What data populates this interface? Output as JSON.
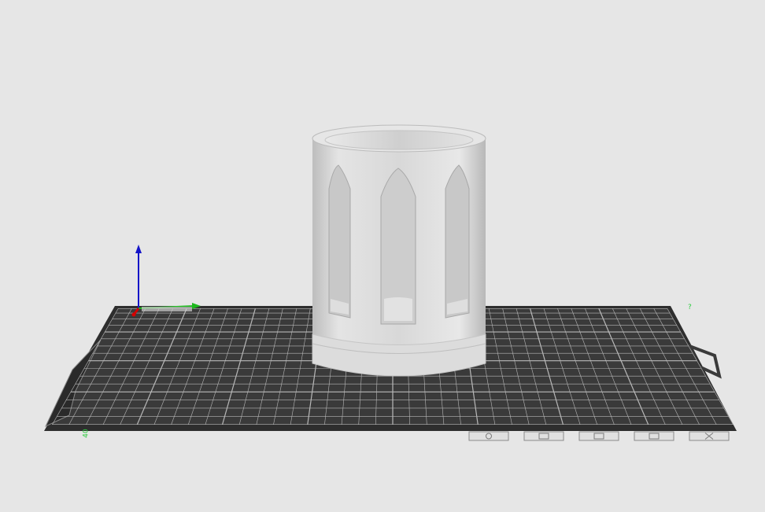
{
  "app": {
    "view": "3d-plater-viewport"
  },
  "scene": {
    "bed_labels": {
      "front_left": "40",
      "back_right": "?"
    },
    "bed_tabs": [
      {
        "icon": "gear-icon"
      },
      {
        "icon": "cube-icon"
      },
      {
        "icon": "layers-icon"
      },
      {
        "icon": "arrange-icon"
      },
      {
        "icon": "close-icon"
      }
    ],
    "colors": {
      "background": "#e6e6e6",
      "bed": "#3a3a3a",
      "grid": "#b8b8b8",
      "model": "#d9d9d9",
      "axis_x": "#d40000",
      "axis_y": "#1db81d",
      "axis_z": "#1414c8"
    }
  }
}
